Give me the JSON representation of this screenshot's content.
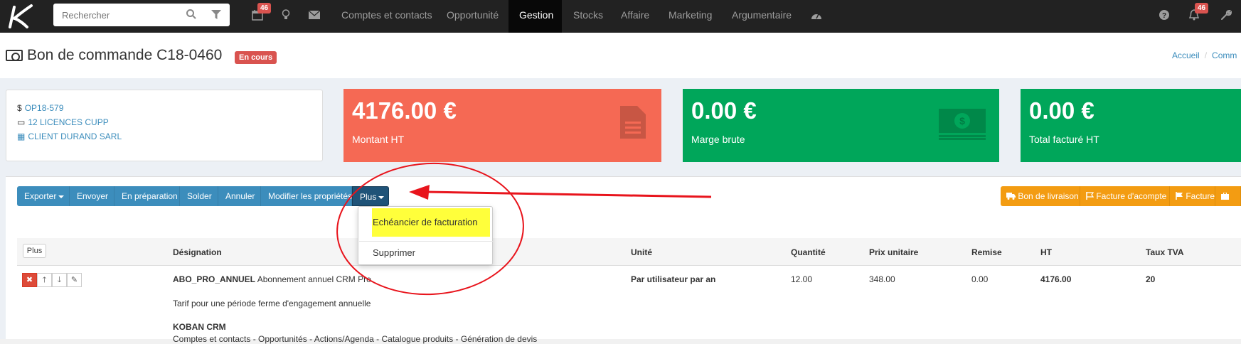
{
  "navbar": {
    "search_placeholder": "Rechercher",
    "calendar_badge": "46",
    "notif_badge": "46",
    "menu": [
      "Comptes et contacts",
      "Opportunité",
      "Gestion",
      "Stocks",
      "Affaire",
      "Marketing",
      "Argumentaire"
    ],
    "active_menu": "Gestion"
  },
  "header": {
    "title": "Bon de commande C18-0460",
    "status": "En cours",
    "breadcrumb_home": "Accueil",
    "breadcrumb_current": "Comm"
  },
  "info": {
    "opportunity": "OP18-579",
    "product": "12 LICENCES CUPP",
    "client": "CLIENT DURAND SARL"
  },
  "stats": [
    {
      "value": "4176.00 €",
      "label": "Montant HT",
      "color": "#f56954"
    },
    {
      "value": "0.00 €",
      "label": "Marge brute",
      "color": "#00a65a"
    },
    {
      "value": "0.00 €",
      "label": "Total facturé HT",
      "color": "#00a65a"
    }
  ],
  "toolbar": {
    "exporter": "Exporter",
    "envoyer": "Envoyer",
    "preparation": "En préparation",
    "solder": "Solder",
    "annuler": "Annuler",
    "modifier": "Modifier les propriétés",
    "plus": "Plus"
  },
  "actions_right": {
    "bon_livraison": "Bon de livraison",
    "facture_acompte": "Facture d'acompte",
    "facture": "Facture"
  },
  "dropdown": {
    "item1": "Echéancier de facturation",
    "item2": "Supprimer"
  },
  "table": {
    "plus": "Plus",
    "headers": {
      "designation": "Désignation",
      "unite": "Unité",
      "quantite": "Quantité",
      "prix": "Prix unitaire",
      "remise": "Remise",
      "ht": "HT",
      "tva": "Taux TVA"
    },
    "row": {
      "code": "ABO_PRO_ANNUEL",
      "label": "Abonnement annuel CRM Pro",
      "unite": "Par utilisateur par an",
      "quantite": "12.00",
      "prix": "348.00",
      "remise": "0.00",
      "ht": "4176.00",
      "tva": "20",
      "desc1": "Tarif pour une période ferme d'engagement annuelle",
      "desc2": "KOBAN CRM",
      "desc3": "Comptes et contacts - Opportunités - Actions/Agenda - Catalogue produits - Génération de devis"
    }
  },
  "colors": {
    "navbar": "#222222",
    "primary": "#3c8dbc",
    "danger": "#dd4b39",
    "success": "#00a65a",
    "warning": "#f39c12",
    "highlight": "#ffff3b",
    "annotation": "#e8141c"
  }
}
